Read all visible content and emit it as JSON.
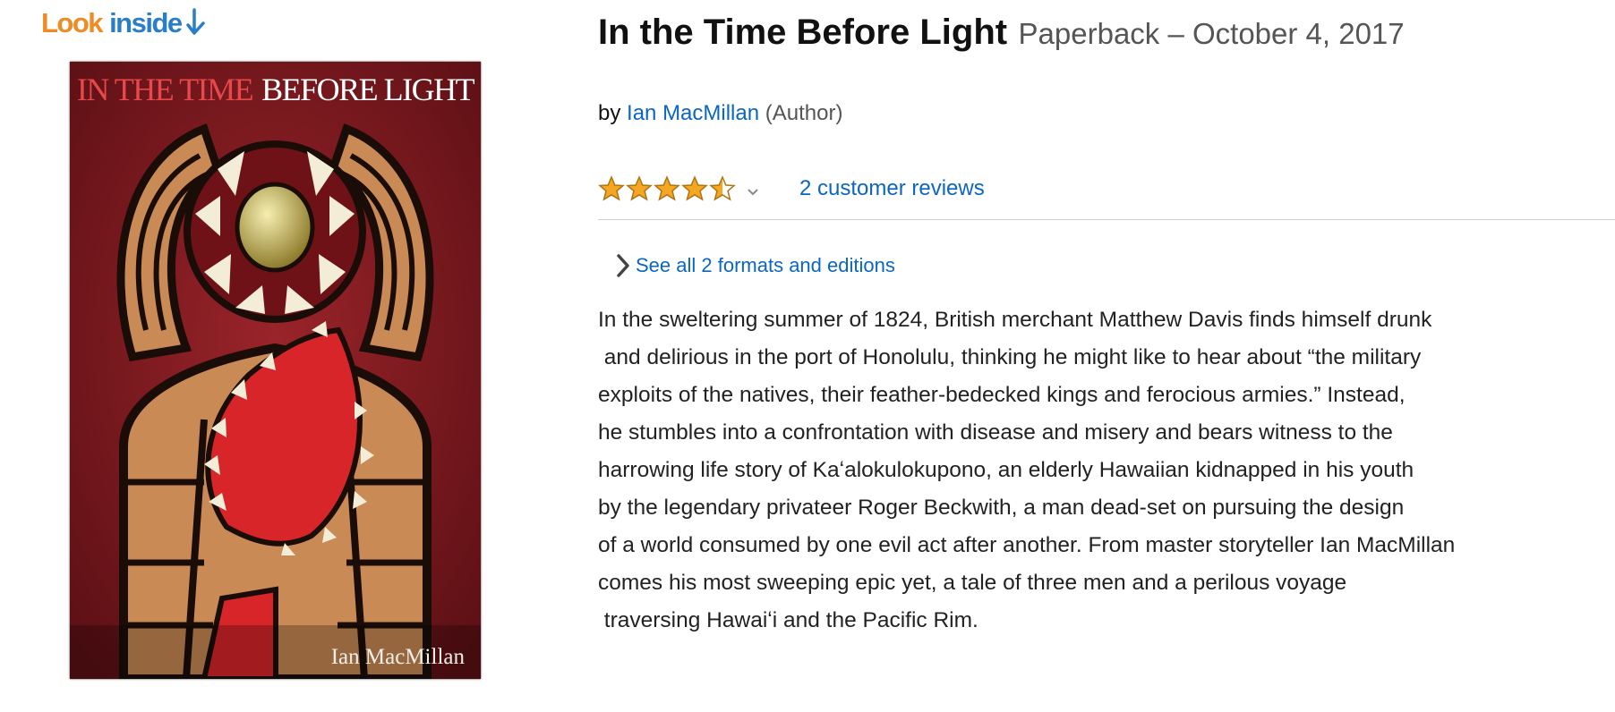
{
  "look_inside": {
    "word1": "Look",
    "word2": "inside"
  },
  "cover": {
    "title_part1": "IN THE TIME",
    "title_part2": "BEFORE LIGHT",
    "author": "Ian MacMillan"
  },
  "product": {
    "title": "In the Time Before Light",
    "format_date": "Paperback – October 4, 2017",
    "by_label": "by",
    "author": "Ian MacMillan",
    "author_role": "(Author)"
  },
  "rating": {
    "value": 4.5,
    "max": 5,
    "reviews_label": "2 customer reviews",
    "star_color": "#f5a623",
    "caret_icon": "chevron-down-icon"
  },
  "formats": {
    "label": "See all 2 formats and editions",
    "icon": "chevron-right-icon"
  },
  "description": "In the sweltering summer of 1824, British merchant Matthew Davis finds himself drunk\n and delirious in the port of Honolulu, thinking he might like to hear about “the military\nexploits of the natives, their feather-bedecked kings and ferocious armies.” Instead,\nhe stumbles into a confrontation with disease and misery and bears witness to the\nharrowing life story of Kaʻalokulokupono, an elderly Hawaiian kidnapped in his youth\nby the legendary privateer Roger Beckwith, a man dead-set on pursuing the design\nof a world consumed by one evil act after another. From master storyteller Ian MacMillan\ncomes his most sweeping epic yet, a tale of three men and a perilous voyage\n traversing Hawaiʻi and the Pacific Rim.",
  "colors": {
    "link": "#0b66c2",
    "look_orange": "#f08a24",
    "look_blue": "#2a7dc9",
    "cover_bg": "#7e1a1f"
  }
}
